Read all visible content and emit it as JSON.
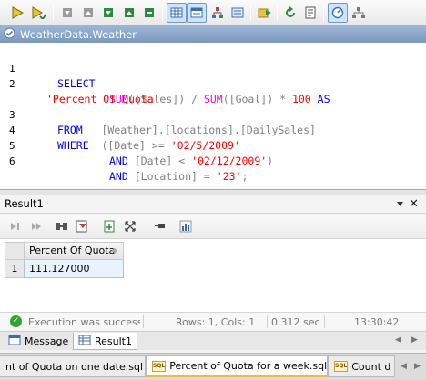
{
  "toolbar": {
    "icons": [
      "execute-icon",
      "execute-step-icon",
      "stop-icon",
      "first-icon",
      "prev-icon",
      "next-icon",
      "last-icon",
      "grid-view-icon",
      "text-view-icon",
      "hierarchy-icon",
      "pane-icon",
      "import-icon",
      "refresh-icon",
      "notes-icon",
      "target-icon",
      "settings-icon"
    ]
  },
  "editor": {
    "title": "WeatherData.Weather",
    "lines": [
      {
        "n": "1",
        "text": "SELECT"
      },
      {
        "n": "2",
        "text": "SUM([Sales]) / SUM([Goal]) * 100 AS"
      },
      {
        "n": "",
        "text": "'Percent Of Quota'"
      },
      {
        "n": "3",
        "text": "FROM [Weather].[locations].[DailySales]"
      },
      {
        "n": "4",
        "text": "WHERE ([Date] >= '02/5/2009'"
      },
      {
        "n": "5",
        "text": "AND [Date] < '02/12/2009')"
      },
      {
        "n": "6",
        "text": "AND [Location] = '23';"
      }
    ]
  },
  "result": {
    "title": "Result1",
    "column": "Percent Of Quota",
    "row_number": "1",
    "value": "111.127000"
  },
  "status": {
    "message": "Execution was successful",
    "rows_cols": "Rows: 1, Cols: 1",
    "duration": "0.312 sec",
    "time": "13:30:42"
  },
  "bottom_tabs": {
    "message": "Message",
    "result": "Result1"
  },
  "doc_tabs": {
    "left": "nt of Quota on one date.sql *",
    "active": "Percent of Quota for a week.sql *",
    "right": "Count d"
  }
}
